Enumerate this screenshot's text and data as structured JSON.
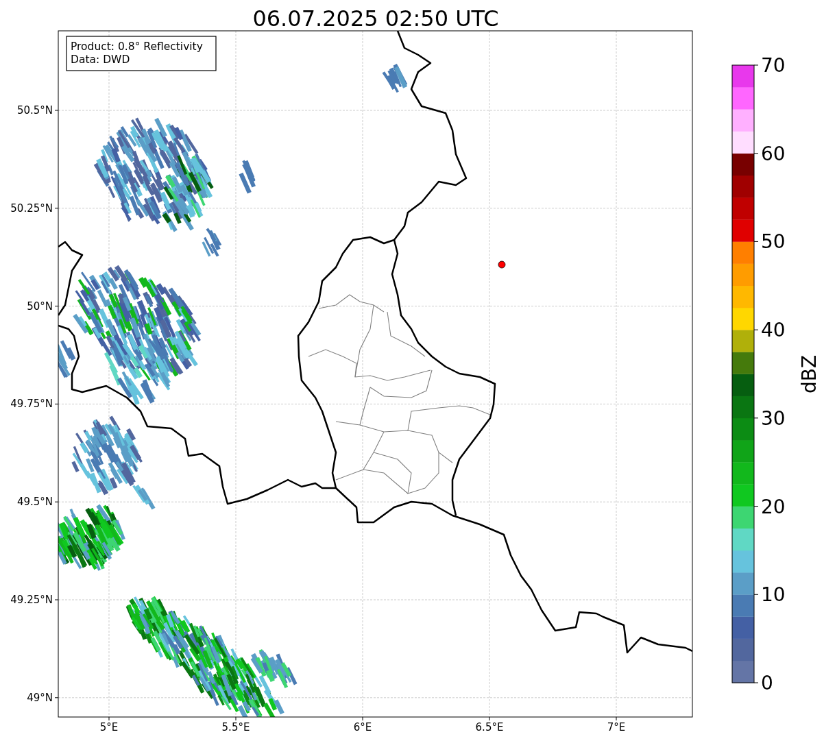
{
  "title": "06.07.2025 02:50 UTC",
  "info_box": {
    "lines": [
      "Product: 0.8° Reflectivity",
      "Data: DWD"
    ]
  },
  "map": {
    "lat_labels": [
      "50.5°N",
      "50.25°N",
      "50°N",
      "49.75°N",
      "49.5°N",
      "49.25°N",
      "49°N"
    ],
    "lon_labels": [
      "5°E",
      "5.5°E",
      "6°E",
      "6.5°E",
      "7°E"
    ]
  },
  "colorbar": {
    "label": "dBZ",
    "tick_labels": [
      "70",
      "60",
      "50",
      "40",
      "30",
      "20",
      "10",
      "0"
    ],
    "bins": [
      {
        "color": "#6475a6"
      },
      {
        "color": "#52679e"
      },
      {
        "color": "#4460a4"
      },
      {
        "color": "#4a7bb3"
      },
      {
        "color": "#5b9ec7"
      },
      {
        "color": "#66c3dd"
      },
      {
        "color": "#60d8c4"
      },
      {
        "color": "#3dd672"
      },
      {
        "color": "#10c820"
      },
      {
        "color": "#12b81c"
      },
      {
        "color": "#10a418"
      },
      {
        "color": "#0c8c14"
      },
      {
        "color": "#0a7612"
      },
      {
        "color": "#065e10"
      },
      {
        "color": "#457a0c"
      },
      {
        "color": "#b0b00a"
      },
      {
        "color": "#ffd700"
      },
      {
        "color": "#ffb800"
      },
      {
        "color": "#ff9c00"
      },
      {
        "color": "#ff7f00"
      },
      {
        "color": "#e00000"
      },
      {
        "color": "#c00000"
      },
      {
        "color": "#a00000"
      },
      {
        "color": "#780000"
      },
      {
        "color": "#ffddff"
      },
      {
        "color": "#ffb0ff"
      },
      {
        "color": "#ff66ff"
      },
      {
        "color": "#e838ec"
      }
    ]
  }
}
